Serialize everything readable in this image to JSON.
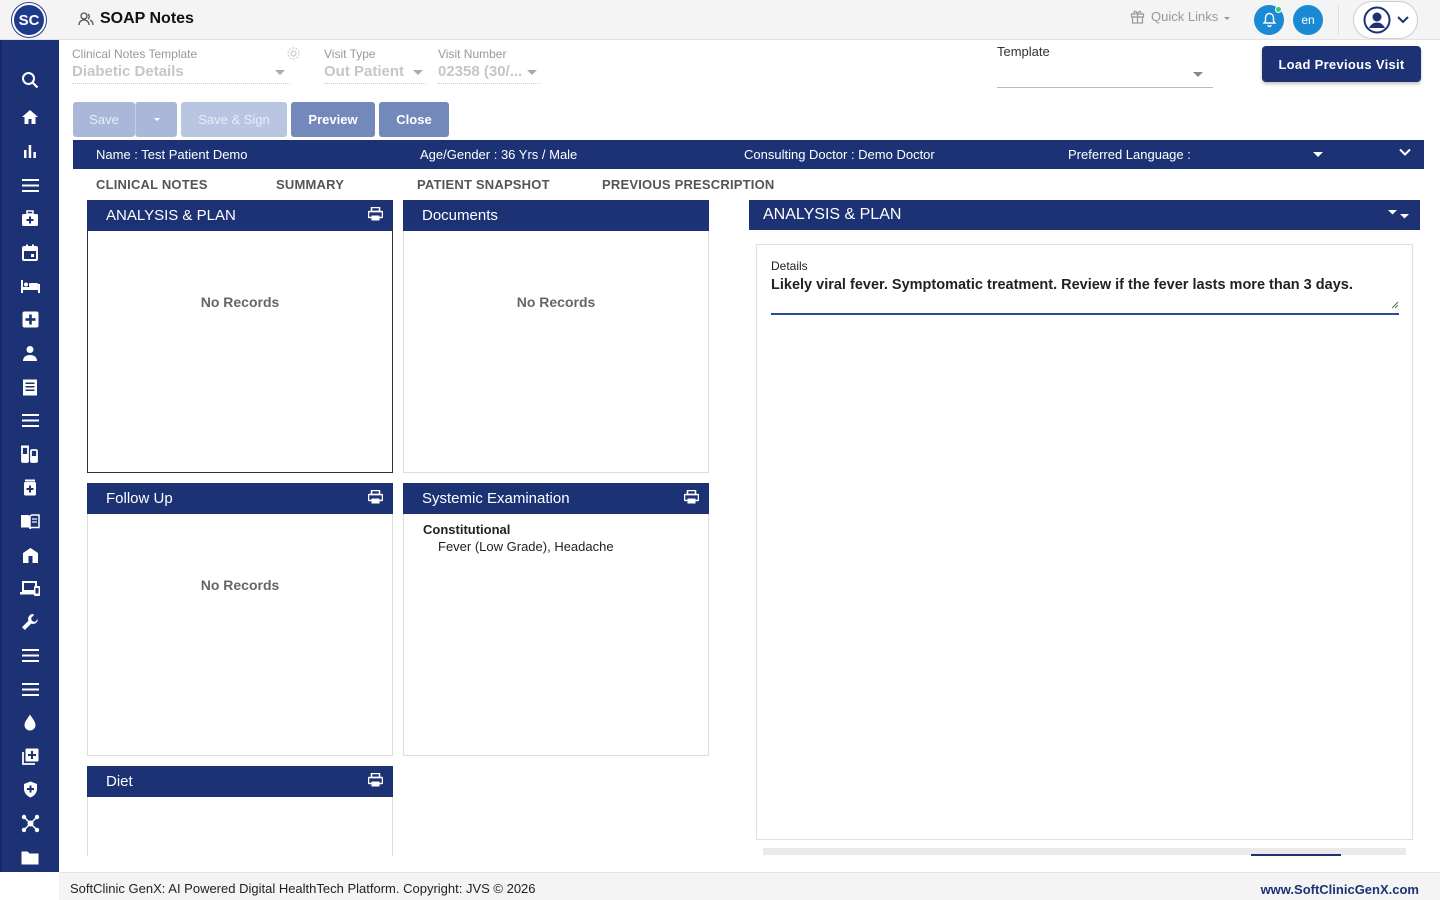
{
  "app": {
    "logo_text": "SC",
    "title": "SOAP Notes",
    "quick_links": "Quick Links",
    "lang": "en"
  },
  "sidebar": {
    "icons": [
      "search-icon",
      "home-icon",
      "bar-chart-icon",
      "menu-icon",
      "medical-bag-icon",
      "calendar-icon",
      "bed-icon",
      "plus-box-icon",
      "person-icon",
      "document-list-icon",
      "menu-icon",
      "lab-icon",
      "pharmacy-icon",
      "book-icon",
      "building-icon",
      "devices-icon",
      "wrench-icon",
      "menu-icon",
      "menu-icon",
      "drop-icon",
      "add-copy-icon",
      "shield-icon",
      "network-icon",
      "folder-icon"
    ]
  },
  "form": {
    "clinical_template_label": "Clinical Notes Template",
    "clinical_template_value": "Diabetic Details",
    "visit_type_label": "Visit Type",
    "visit_type_value": "Out Patient",
    "visit_number_label": "Visit Number",
    "visit_number_value": "02358 (30/...",
    "template_label": "Template",
    "load_previous_visit": "Load Previous Visit"
  },
  "actions": {
    "save": "Save",
    "save_sign": "Save & Sign",
    "preview": "Preview",
    "close": "Close"
  },
  "patient": {
    "name": "Name :  Test Patient Demo",
    "age_gender": "Age/Gender :  36 Yrs / Male",
    "doctor": "Consulting Doctor :  Demo Doctor",
    "language": "Preferred Language :"
  },
  "tabs": [
    "CLINICAL NOTES",
    "SUMMARY",
    "PATIENT SNAPSHOT",
    "PREVIOUS PRESCRIPTION"
  ],
  "cards": {
    "analysis_plan": {
      "title": "ANALYSIS & PLAN",
      "empty": "No Records"
    },
    "documents": {
      "title": "Documents",
      "empty": "No Records"
    },
    "follow_up": {
      "title": "Follow Up",
      "empty": "No Records"
    },
    "systemic_exam": {
      "title": "Systemic Examination",
      "section": "Constitutional",
      "value": "Fever (Low Grade), Headache"
    },
    "diet": {
      "title": "Diet"
    }
  },
  "detail_panel": {
    "title": "ANALYSIS & PLAN",
    "details_label": "Details",
    "details_value": "Likely viral fever. Symptomatic treatment. Review if the fever lasts more than 3 days."
  },
  "footer": {
    "copyright": "SoftClinic GenX: AI Powered Digital HealthTech Platform. Copyright: JVS © 2026",
    "website": "www.SoftClinicGenX.com"
  },
  "colors": {
    "primary": "#1d3274",
    "accent": "#1a8ad4"
  }
}
